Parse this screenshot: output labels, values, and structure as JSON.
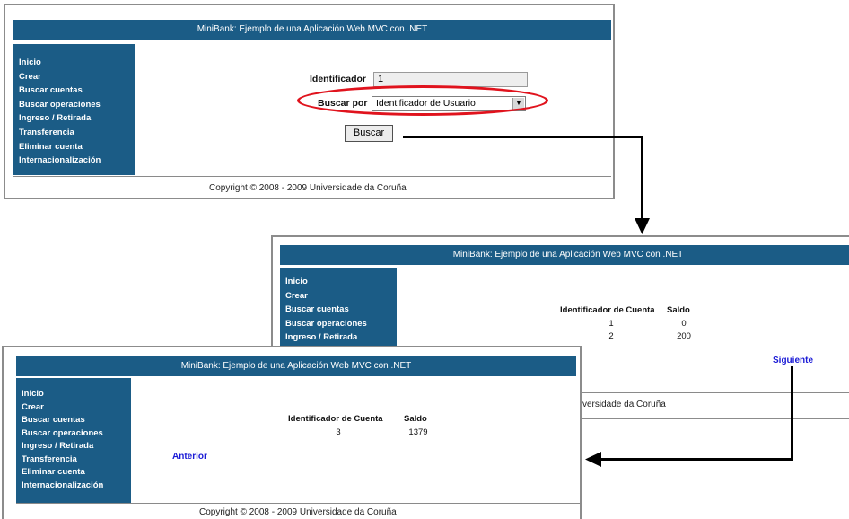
{
  "app": {
    "title": "MiniBank: Ejemplo de una Aplicación Web MVC con .NET",
    "menu": [
      "Inicio",
      "Crear",
      "Buscar cuentas",
      "Buscar operaciones",
      "Ingreso / Retirada",
      "Transferencia",
      "Eliminar cuenta",
      "Internacionalización"
    ],
    "footer": "Copyright © 2008 - 2009 Universidade da Coruña"
  },
  "search_window": {
    "identifier_label": "Identificador",
    "identifier_value": "1",
    "search_by_label": "Buscar por",
    "search_by_value": "Identificador de Usuario",
    "search_button": "Buscar"
  },
  "results_page1": {
    "col_account": "Identificador de Cuenta",
    "col_balance": "Saldo",
    "rows": [
      {
        "account": "1",
        "balance": "0"
      },
      {
        "account": "2",
        "balance": "200"
      }
    ],
    "next_link": "Siguiente",
    "footer_partial": "versidade da Coruña"
  },
  "results_page2": {
    "col_account": "Identificador de Cuenta",
    "col_balance": "Saldo",
    "rows": [
      {
        "account": "3",
        "balance": "1379"
      }
    ],
    "prev_link": "Anterior"
  },
  "colors": {
    "header_blue": "#1b5c86",
    "highlight_red": "#e0131d",
    "link_blue": "#1a1ad6"
  }
}
